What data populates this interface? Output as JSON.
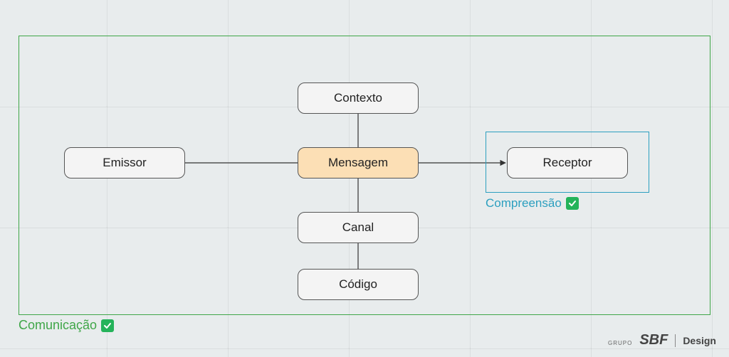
{
  "diagram": {
    "outer_frame_label": "Comunicação",
    "inner_frame_label": "Compreensão",
    "nodes": {
      "emissor": "Emissor",
      "contexto": "Contexto",
      "mensagem": "Mensagem",
      "canal": "Canal",
      "codigo": "Código",
      "receptor": "Receptor"
    },
    "highlight_node": "mensagem",
    "edges": [
      {
        "from": "emissor",
        "to": "mensagem",
        "arrow": false
      },
      {
        "from": "mensagem",
        "to": "receptor",
        "arrow": true
      },
      {
        "from": "contexto",
        "to": "mensagem",
        "arrow": false
      },
      {
        "from": "mensagem",
        "to": "canal",
        "arrow": false
      },
      {
        "from": "canal",
        "to": "codigo",
        "arrow": false
      }
    ]
  },
  "colors": {
    "outer_frame": "#3fa648",
    "inner_frame": "#2c9fbf",
    "node_bg": "#f4f4f4",
    "node_highlight_bg": "#fcdfb5",
    "node_border": "#555555",
    "check_bg": "#24b35a"
  },
  "footer": {
    "grupo": "GRUPO",
    "brand": "SBF",
    "section": "Design"
  }
}
